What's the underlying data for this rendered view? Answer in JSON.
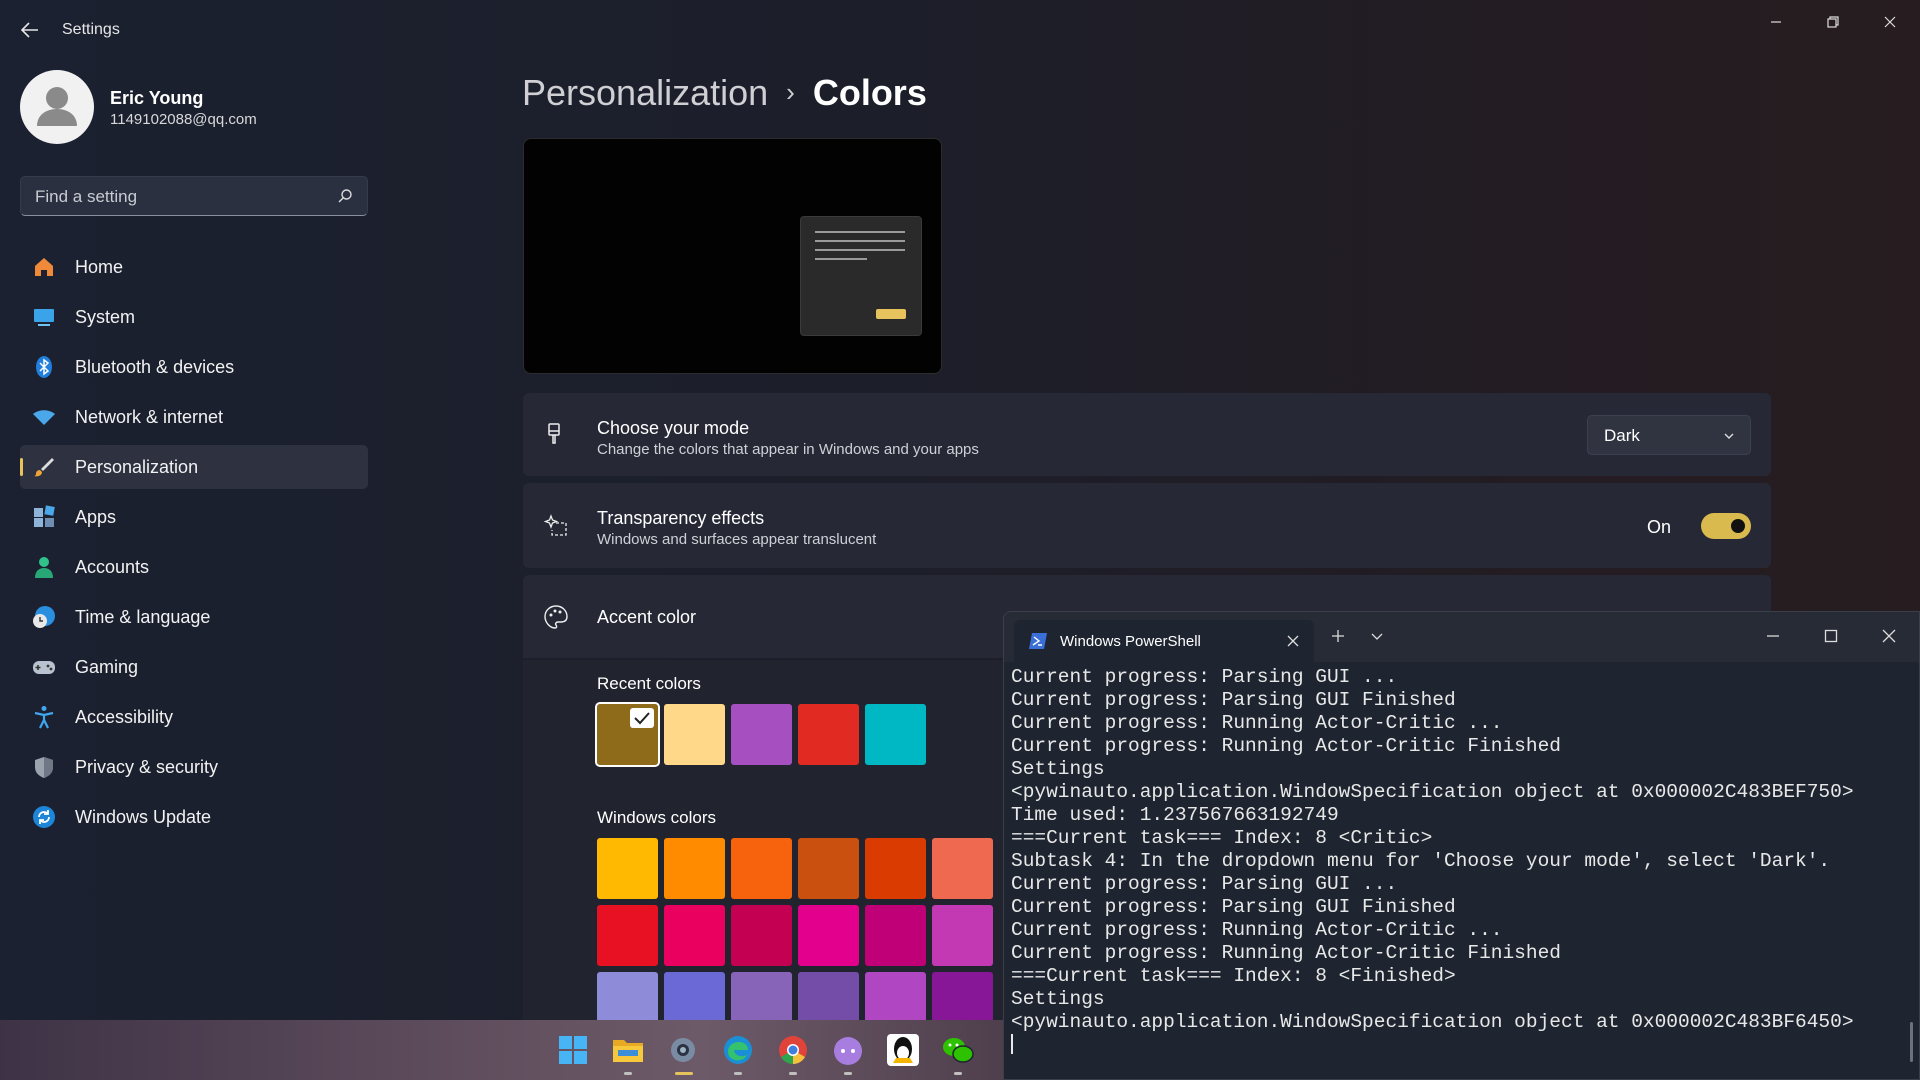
{
  "window": {
    "title": "Settings",
    "back_icon": "arrow-left-icon",
    "controls": [
      "minimize-icon",
      "restore-icon",
      "close-icon"
    ]
  },
  "profile": {
    "name": "Eric Young",
    "email": "1149102088@qq.com"
  },
  "search": {
    "placeholder": "Find a setting"
  },
  "nav": {
    "items": [
      {
        "label": "Home",
        "icon": "home-icon"
      },
      {
        "label": "System",
        "icon": "monitor-icon"
      },
      {
        "label": "Bluetooth & devices",
        "icon": "bluetooth-icon"
      },
      {
        "label": "Network & internet",
        "icon": "wifi-icon"
      },
      {
        "label": "Personalization",
        "icon": "brush-icon",
        "selected": true
      },
      {
        "label": "Apps",
        "icon": "apps-icon"
      },
      {
        "label": "Accounts",
        "icon": "person-icon"
      },
      {
        "label": "Time & language",
        "icon": "globe-clock-icon"
      },
      {
        "label": "Gaming",
        "icon": "gamepad-icon"
      },
      {
        "label": "Accessibility",
        "icon": "accessibility-icon"
      },
      {
        "label": "Privacy & security",
        "icon": "shield-icon"
      },
      {
        "label": "Windows Update",
        "icon": "refresh-icon"
      }
    ]
  },
  "breadcrumb": {
    "parent": "Personalization",
    "separator": "›",
    "current": "Colors"
  },
  "mode_card": {
    "title": "Choose your mode",
    "subtitle": "Change the colors that appear in Windows and your apps",
    "value": "Dark",
    "icon": "paint-brush-icon"
  },
  "transparency_card": {
    "title": "Transparency effects",
    "subtitle": "Windows and surfaces appear translucent",
    "state_label": "On",
    "checked": true,
    "icon": "sparkle-icon"
  },
  "accent_card": {
    "title": "Accent color",
    "icon": "palette-icon",
    "recent_label": "Recent colors",
    "recent_colors": [
      "#8e6b1a",
      "#ffd88a",
      "#a64fc0",
      "#e12a22",
      "#00b8c4"
    ],
    "windows_label": "Windows colors",
    "windows_colors": [
      [
        "#ffb900",
        "#ff8c00",
        "#f7630c",
        "#ca5010",
        "#da3b01",
        "#ef6950"
      ],
      [
        "#e81123",
        "#ea005e",
        "#c30052",
        "#e3008c",
        "#bf0077",
        "#c239b3"
      ],
      [
        "#8e8cd8",
        "#6b69d6",
        "#8764b8",
        "#744da9",
        "#b146c2",
        "#881798"
      ]
    ]
  },
  "powershell": {
    "tab_title": "Windows PowerShell",
    "lines": [
      "Current progress: Parsing GUI ...",
      "Current progress: Parsing GUI Finished",
      "Current progress: Running Actor-Critic ...",
      "Current progress: Running Actor-Critic Finished",
      "Settings",
      "<pywinauto.application.WindowSpecification object at 0x000002C483BEF750>",
      "Time used: 1.237567663192749",
      "===Current task=== Index: 8 <Critic>",
      "Subtask 4: In the dropdown menu for 'Choose your mode', select 'Dark'.",
      "Current progress: Parsing GUI ...",
      "Current progress: Parsing GUI Finished",
      "Current progress: Running Actor-Critic ...",
      "Current progress: Running Actor-Critic Finished",
      "===Current task=== Index: 8 <Finished>",
      "Settings",
      "<pywinauto.application.WindowSpecification object at 0x000002C483BF6450>"
    ]
  },
  "taskbar": {
    "apps": [
      {
        "name": "start-icon",
        "running": false
      },
      {
        "name": "file-explorer-icon",
        "running": true
      },
      {
        "name": "settings-icon",
        "running": true,
        "active": true
      },
      {
        "name": "edge-icon",
        "running": true
      },
      {
        "name": "chrome-icon",
        "running": true
      },
      {
        "name": "cat-app-icon",
        "running": true
      },
      {
        "name": "qq-penguin-icon",
        "running": false
      },
      {
        "name": "wechat-icon",
        "running": true
      }
    ]
  },
  "colors": {
    "accent": "#e6c35c",
    "nav_selected_bg": "#2d3140"
  }
}
